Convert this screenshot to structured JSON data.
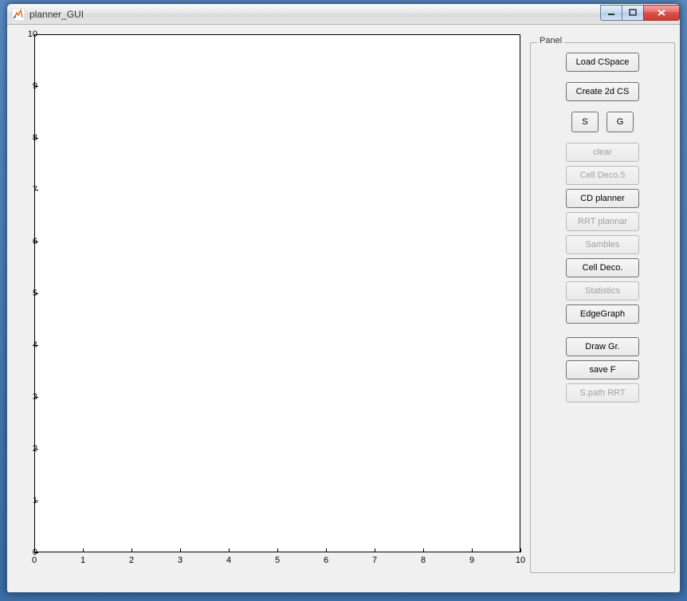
{
  "window": {
    "title": "planner_GUI"
  },
  "panel": {
    "legend": "Panel",
    "buttons": {
      "load_cspace": "Load CSpace",
      "create_2d_cs": "Create 2d CS",
      "s": "S",
      "g": "G",
      "clear": "clear",
      "cell_deco_5": "Cell Deco.5",
      "cd_planner": "CD planner",
      "rrt_plannar": "RRT plannar",
      "sambles": "Sambles",
      "cell_deco": "Cell Deco.",
      "statistics": "Statistics",
      "edge_graph": "EdgeGraph",
      "draw_gr": "Draw Gr.",
      "save_f": "save F",
      "s_path_rrt": "S.path RRT"
    }
  },
  "chart_data": {
    "type": "scatter",
    "x": [],
    "y": [],
    "title": "",
    "xlabel": "",
    "ylabel": "",
    "xlim": [
      0,
      10
    ],
    "ylim": [
      0,
      10
    ],
    "xticks": [
      0,
      1,
      2,
      3,
      4,
      5,
      6,
      7,
      8,
      9,
      10
    ],
    "yticks": [
      0,
      1,
      2,
      3,
      4,
      5,
      6,
      7,
      8,
      9,
      10
    ]
  }
}
